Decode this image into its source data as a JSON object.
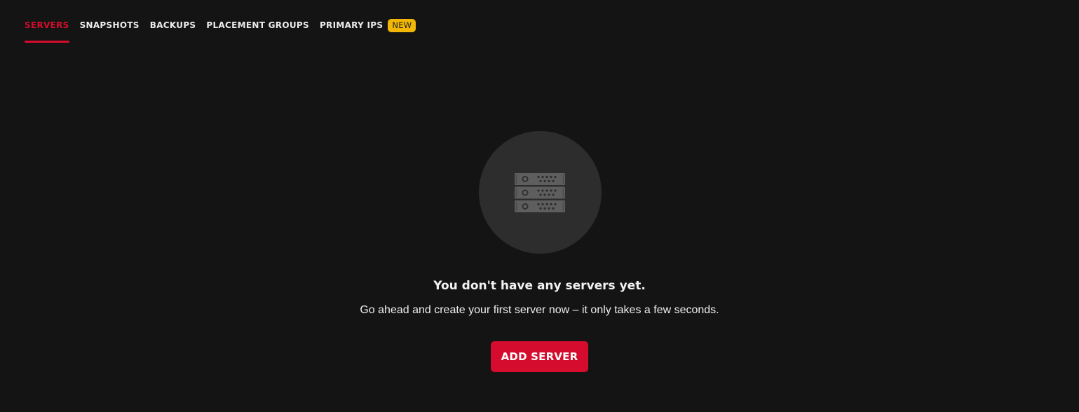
{
  "tabs": [
    {
      "label": "SERVERS",
      "active": true
    },
    {
      "label": "SNAPSHOTS",
      "active": false
    },
    {
      "label": "BACKUPS",
      "active": false
    },
    {
      "label": "PLACEMENT GROUPS",
      "active": false
    },
    {
      "label": "PRIMARY IPS",
      "active": false,
      "badge": "NEW"
    }
  ],
  "empty_state": {
    "icon": "server-rack-icon",
    "headline": "You don't have any servers yet.",
    "description": "Go ahead and create your first server now – it only takes a few seconds.",
    "button_label": "ADD SERVER"
  },
  "colors": {
    "background": "#141414",
    "accent": "#d50c2d",
    "badge": "#f2b705",
    "icon_circle": "#2d2d2d",
    "icon": "#5e5e5e"
  }
}
